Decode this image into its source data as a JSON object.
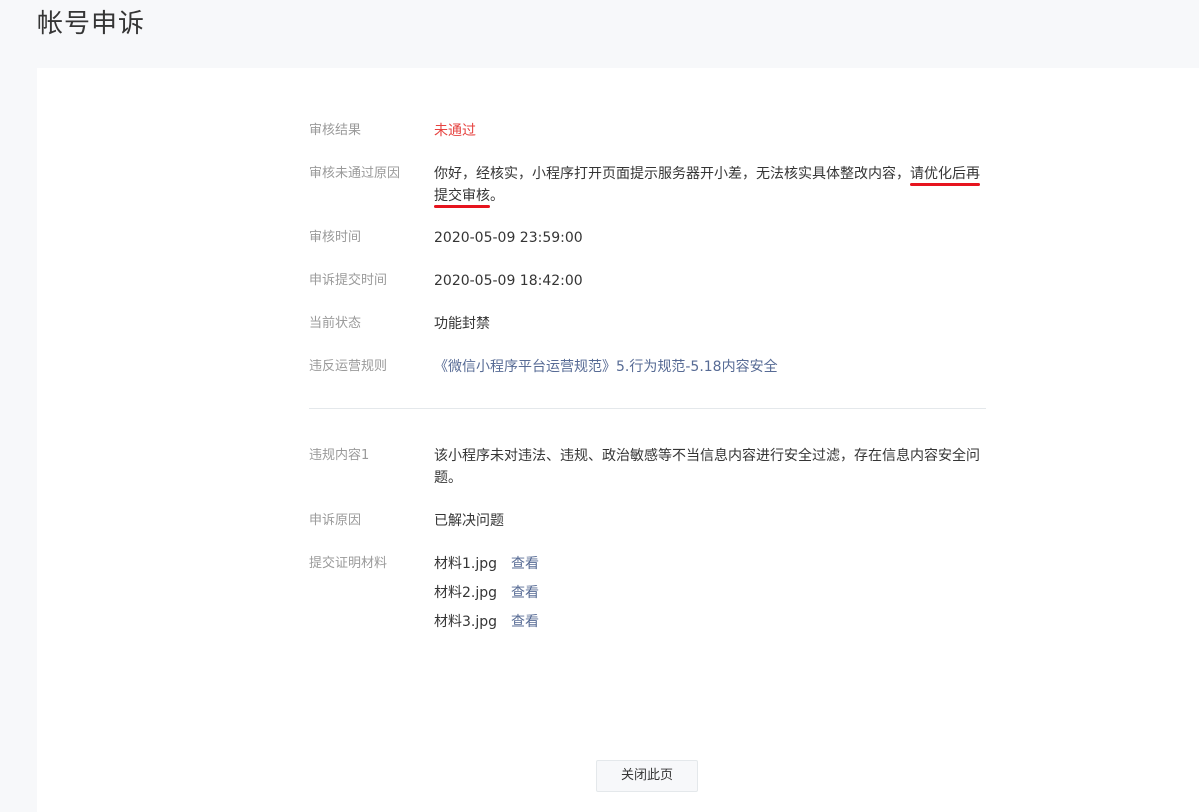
{
  "page": {
    "title": "帐号申诉"
  },
  "review": {
    "result_label": "审核结果",
    "result_value": "未通过",
    "reason_label": "审核未通过原因",
    "reason_text_plain": "你好，经核实，小程序打开页面提示服务器开小差，无法核实具体整改内容，",
    "reason_text_highlight_1": "请优化后再",
    "reason_text_highlight_2": "提交审核",
    "reason_text_end": "。",
    "time_label": "审核时间",
    "time_value": "2020-05-09 23:59:00",
    "submit_time_label": "申诉提交时间",
    "submit_time_value": "2020-05-09 18:42:00",
    "status_label": "当前状态",
    "status_value": "功能封禁",
    "rule_label": "违反运营规则",
    "rule_value": "《微信小程序平台运营规范》5.行为规范-5.18内容安全"
  },
  "violation": {
    "content_label": "违规内容1",
    "content_value": "该小程序未对违法、违规、政治敏感等不当信息内容进行安全过滤，存在信息内容安全问题。",
    "appeal_reason_label": "申诉原因",
    "appeal_reason_value": "已解决问题",
    "evidence_label": "提交证明材料",
    "files": [
      {
        "name": "材料1.jpg",
        "action": "查看"
      },
      {
        "name": "材料2.jpg",
        "action": "查看"
      },
      {
        "name": "材料3.jpg",
        "action": "查看"
      }
    ]
  },
  "footer": {
    "close_label": "关闭此页"
  },
  "colors": {
    "fail": "#e64340",
    "link": "#576b95",
    "annotation": "#e6141e"
  }
}
